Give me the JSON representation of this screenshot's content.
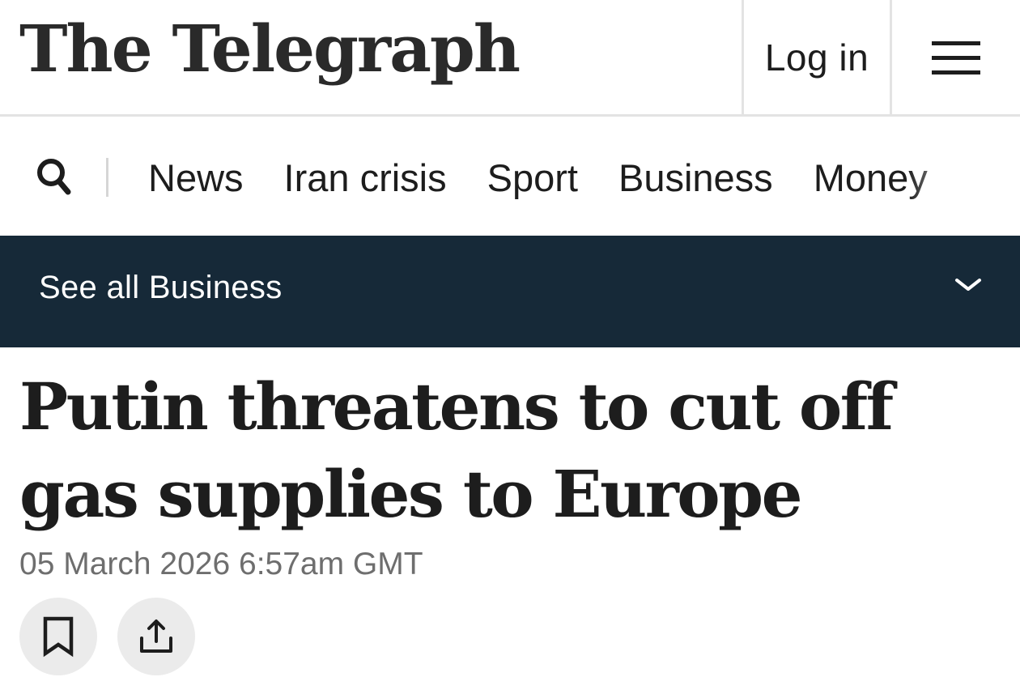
{
  "masthead": {
    "logo_text": "The Telegraph",
    "login_label": "Log in",
    "menu_icon": "hamburger-menu-icon"
  },
  "nav": {
    "search_icon": "search-icon",
    "items": [
      {
        "label": "News"
      },
      {
        "label": "Iran crisis"
      },
      {
        "label": "Sport"
      },
      {
        "label": "Business"
      },
      {
        "label": "Money"
      }
    ]
  },
  "section": {
    "label": "See all Business",
    "icon": "chevron-down-icon"
  },
  "article": {
    "headline": "Putin threatens to cut off gas supplies to Europe",
    "timestamp": "05 March 2026 6:57am GMT",
    "actions": [
      {
        "icon": "bookmark-icon"
      },
      {
        "icon": "share-icon"
      }
    ]
  },
  "colors": {
    "section_bar_bg": "#162938",
    "text_primary": "#1d1d1d",
    "text_secondary": "#6e6e6e",
    "action_button_bg": "#ebebeb"
  }
}
